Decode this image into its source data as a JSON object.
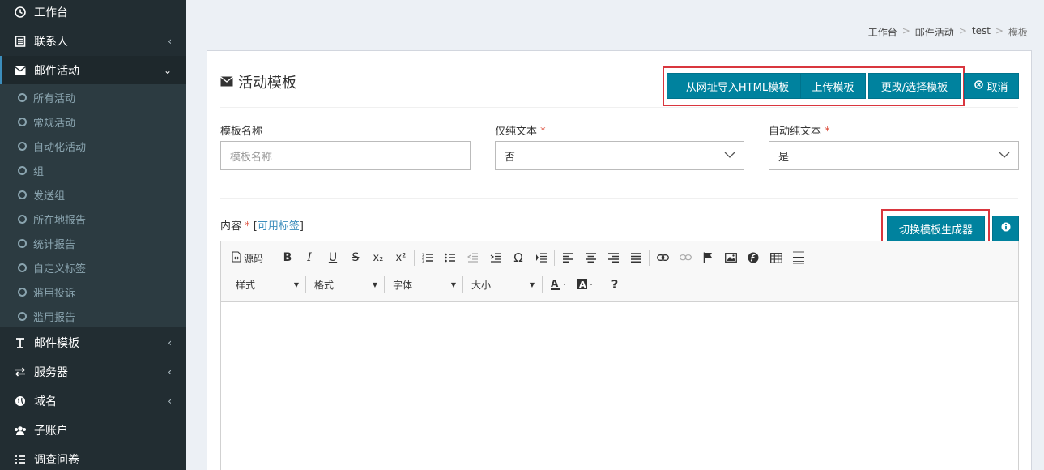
{
  "sidebar": {
    "items_top": [
      {
        "label": "工作台",
        "icon": "dashboard-icon"
      },
      {
        "label": "联系人",
        "icon": "contacts-icon"
      },
      {
        "label": "邮件活动",
        "icon": "envelope-icon"
      }
    ],
    "sub_items": [
      "所有活动",
      "常规活动",
      "自动化活动",
      "组",
      "发送组",
      "所在地报告",
      "统计报告",
      "自定义标签",
      "滥用投诉",
      "滥用报告"
    ],
    "items_bottom": [
      {
        "label": "邮件模板",
        "icon": "text-icon"
      },
      {
        "label": "服务器",
        "icon": "exchange-icon"
      },
      {
        "label": "域名",
        "icon": "globe-icon"
      },
      {
        "label": "子账户",
        "icon": "users-icon"
      },
      {
        "label": "调查问卷",
        "icon": "list-icon"
      }
    ]
  },
  "breadcrumb": [
    "工作台",
    "邮件活动",
    "test",
    "模板"
  ],
  "box": {
    "title": "活动模板",
    "buttons": {
      "import_html": "从网址导入HTML模板",
      "upload": "上传模板",
      "change_select": "更改/选择模板",
      "cancel": "取消",
      "toggle_builder": "切换模板生成器"
    }
  },
  "form": {
    "name_label": "模板名称",
    "name_placeholder": "模板名称",
    "plain_label": "仅纯文本",
    "plain_value": "否",
    "auto_plain_label": "自动纯文本",
    "auto_plain_value": "是",
    "required_mark": "*",
    "content_label": "内容",
    "tags_link": "可用标签"
  },
  "editor": {
    "source_label": "源码",
    "combos": [
      "样式",
      "格式",
      "字体",
      "大小"
    ]
  },
  "colors": {
    "primary": "#00829e",
    "sidebar_bg": "#222d32",
    "highlight_border": "#d9363e"
  }
}
